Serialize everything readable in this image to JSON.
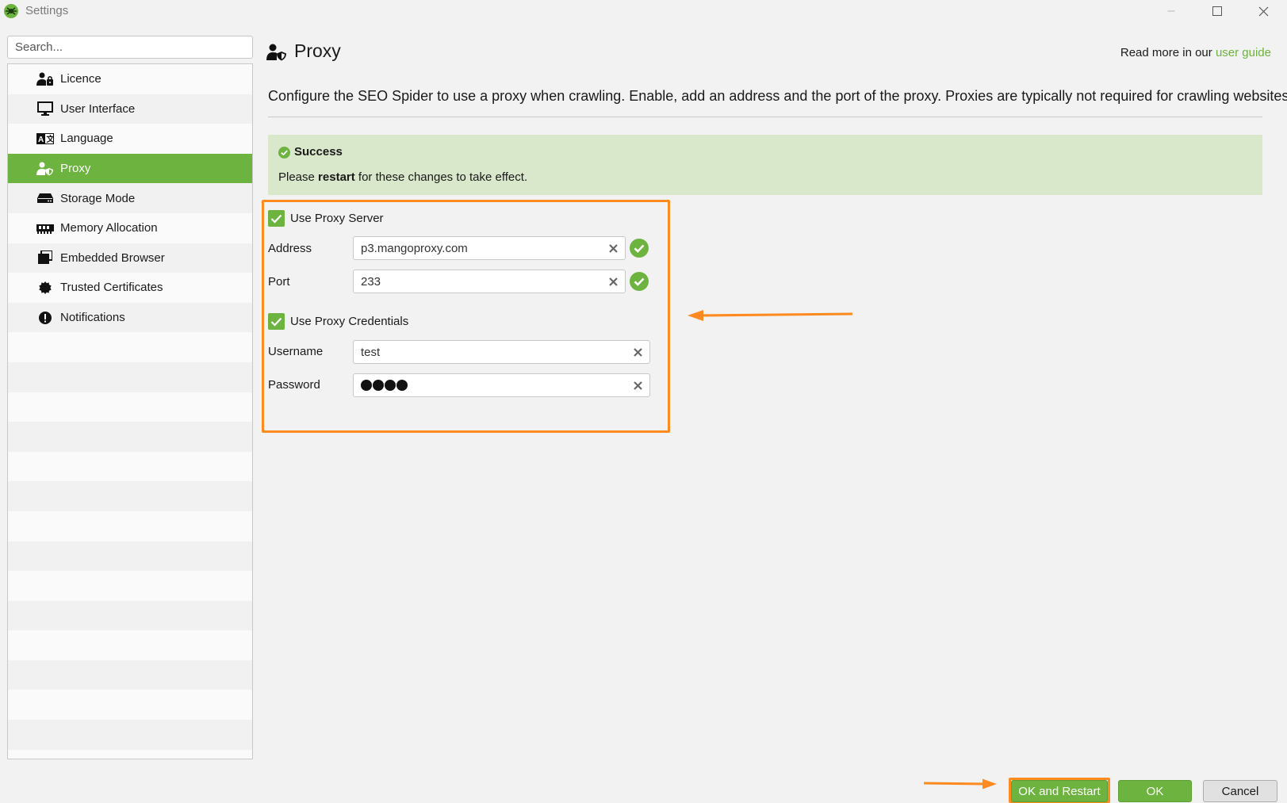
{
  "window": {
    "title": "Settings",
    "minimize_glyph": "–",
    "maximize_glyph": "☐",
    "close_glyph": "✕"
  },
  "search": {
    "placeholder": "Search..."
  },
  "sidebar": {
    "items": [
      {
        "label": "Licence",
        "icon": "user-lock-icon",
        "active": false
      },
      {
        "label": "User Interface",
        "icon": "monitor-icon",
        "active": false
      },
      {
        "label": "Language",
        "icon": "language-icon",
        "active": false
      },
      {
        "label": "Proxy",
        "icon": "user-shield-icon",
        "active": true
      },
      {
        "label": "Storage Mode",
        "icon": "hard-drive-icon",
        "active": false
      },
      {
        "label": "Memory Allocation",
        "icon": "memory-icon",
        "active": false
      },
      {
        "label": "Embedded Browser",
        "icon": "browser-window-icon",
        "active": false
      },
      {
        "label": "Trusted Certificates",
        "icon": "certificate-icon",
        "active": false
      },
      {
        "label": "Notifications",
        "icon": "alert-icon",
        "active": false
      }
    ]
  },
  "page": {
    "title": "Proxy",
    "read_more_prefix": "Read more in our ",
    "read_more_link": "user guide",
    "description": "Configure the SEO Spider to use a proxy when crawling. Enable, add an address and the port of the proxy. Proxies are typically not required for crawling websites."
  },
  "success": {
    "title": "Success",
    "msg_prefix": "Please ",
    "msg_bold": "restart",
    "msg_suffix": " for these changes to take effect."
  },
  "form": {
    "use_proxy_server_label": "Use Proxy Server",
    "use_proxy_server_checked": true,
    "address_label": "Address",
    "address_value": "p3.mangoproxy.com",
    "port_label": "Port",
    "port_value": "233",
    "use_proxy_credentials_label": "Use Proxy Credentials",
    "use_proxy_credentials_checked": true,
    "username_label": "Username",
    "username_value": "test",
    "password_label": "Password",
    "password_length": 4
  },
  "buttons": {
    "ok_and_restart": "OK and Restart",
    "ok": "OK",
    "cancel": "Cancel"
  },
  "colors": {
    "accent_green": "#6db33f",
    "highlight_orange": "#ff8a1f",
    "success_bg": "#d9e7cb"
  }
}
